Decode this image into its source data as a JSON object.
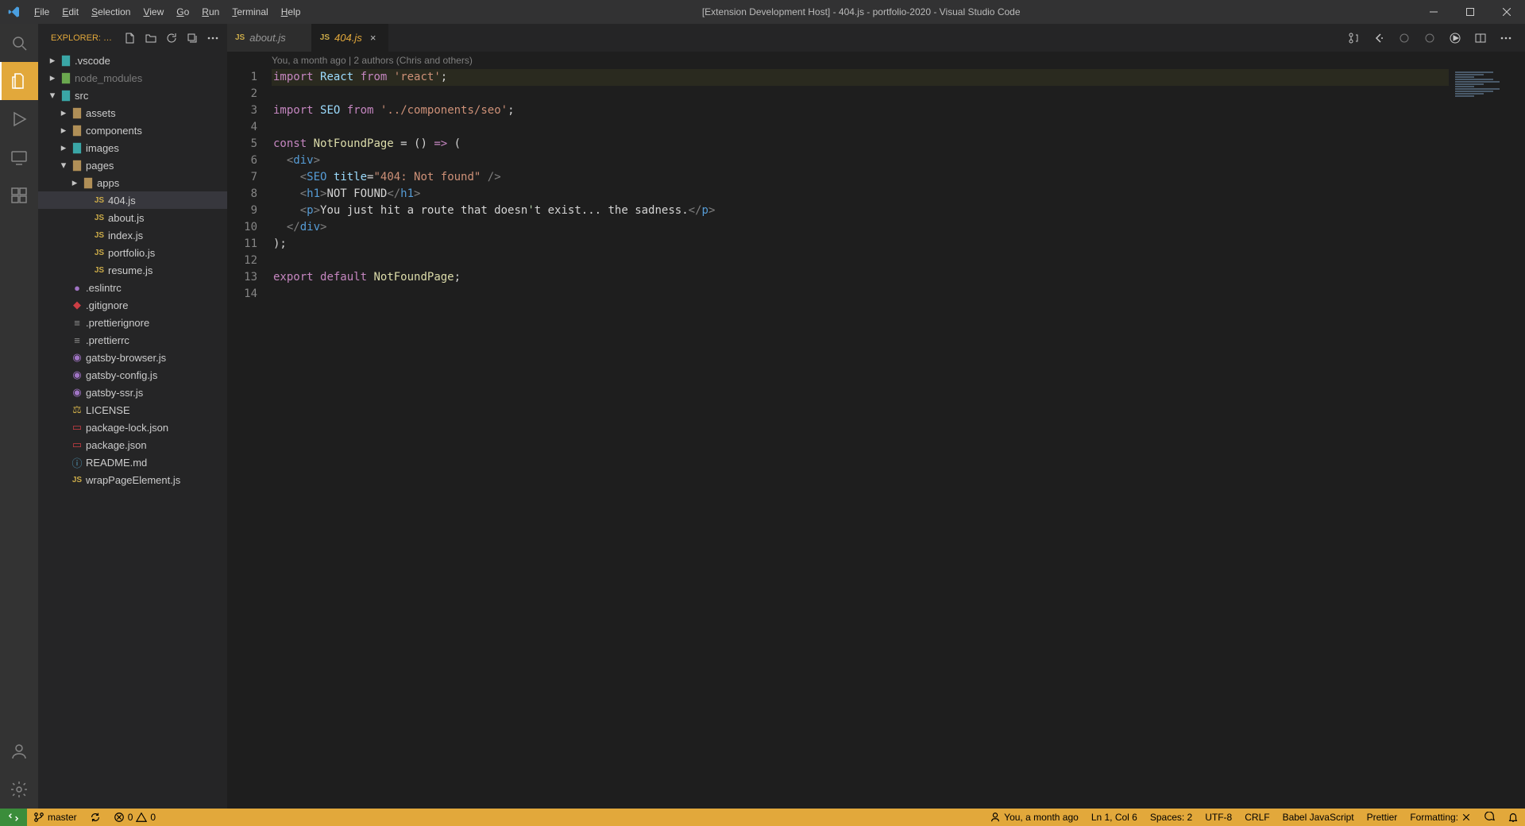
{
  "window": {
    "title": "[Extension Development Host] - 404.js - portfolio-2020 - Visual Studio Code"
  },
  "menu": [
    "File",
    "Edit",
    "Selection",
    "View",
    "Go",
    "Run",
    "Terminal",
    "Help"
  ],
  "sidebar": {
    "title": "EXPLORER: …",
    "tree": [
      {
        "kind": "folder",
        "depth": 0,
        "chev": "right",
        "icon": "folder-teal",
        "label": ".vscode"
      },
      {
        "kind": "folder",
        "depth": 0,
        "chev": "right",
        "icon": "folder-green",
        "label": "node_modules",
        "dim": true
      },
      {
        "kind": "folder",
        "depth": 0,
        "chev": "down",
        "icon": "folder-teal",
        "label": "src"
      },
      {
        "kind": "folder",
        "depth": 1,
        "chev": "right",
        "icon": "folder",
        "label": "assets"
      },
      {
        "kind": "folder",
        "depth": 1,
        "chev": "right",
        "icon": "folder",
        "label": "components"
      },
      {
        "kind": "folder",
        "depth": 1,
        "chev": "right",
        "icon": "folder-teal",
        "label": "images"
      },
      {
        "kind": "folder",
        "depth": 1,
        "chev": "down",
        "icon": "folder",
        "label": "pages"
      },
      {
        "kind": "folder",
        "depth": 2,
        "chev": "right",
        "icon": "folder",
        "label": "apps"
      },
      {
        "kind": "file",
        "depth": 3,
        "icon": "js",
        "label": "404.js",
        "active": true
      },
      {
        "kind": "file",
        "depth": 3,
        "icon": "js",
        "label": "about.js"
      },
      {
        "kind": "file",
        "depth": 3,
        "icon": "js",
        "label": "index.js"
      },
      {
        "kind": "file",
        "depth": 3,
        "icon": "js",
        "label": "portfolio.js"
      },
      {
        "kind": "file",
        "depth": 3,
        "icon": "js",
        "label": "resume.js"
      },
      {
        "kind": "file",
        "depth": 1,
        "icon": "dot-purple",
        "label": ".eslintrc"
      },
      {
        "kind": "file",
        "depth": 1,
        "icon": "git-red",
        "label": ".gitignore"
      },
      {
        "kind": "file",
        "depth": 1,
        "icon": "gray",
        "label": ".prettierignore"
      },
      {
        "kind": "file",
        "depth": 1,
        "icon": "gray",
        "label": ".prettierrc"
      },
      {
        "kind": "file",
        "depth": 1,
        "icon": "purple",
        "label": "gatsby-browser.js"
      },
      {
        "kind": "file",
        "depth": 1,
        "icon": "purple",
        "label": "gatsby-config.js"
      },
      {
        "kind": "file",
        "depth": 1,
        "icon": "purple",
        "label": "gatsby-ssr.js"
      },
      {
        "kind": "file",
        "depth": 1,
        "icon": "yellow",
        "label": "LICENSE"
      },
      {
        "kind": "file",
        "depth": 1,
        "icon": "red",
        "label": "package-lock.json"
      },
      {
        "kind": "file",
        "depth": 1,
        "icon": "red",
        "label": "package.json"
      },
      {
        "kind": "file",
        "depth": 1,
        "icon": "blue",
        "label": "README.md"
      },
      {
        "kind": "file",
        "depth": 1,
        "icon": "js",
        "label": "wrapPageElement.js"
      }
    ]
  },
  "tabs": [
    {
      "icon": "js",
      "label": "about.js",
      "active": false
    },
    {
      "icon": "js",
      "label": "404.js",
      "active": true
    }
  ],
  "blame": "You, a month ago | 2 authors (Chris and others)",
  "code": {
    "lines": [
      [
        {
          "t": "kw",
          "v": "import"
        },
        {
          "t": "txt",
          "v": " "
        },
        {
          "t": "id",
          "v": "React"
        },
        {
          "t": "txt",
          "v": " "
        },
        {
          "t": "kw",
          "v": "from"
        },
        {
          "t": "txt",
          "v": " "
        },
        {
          "t": "str",
          "v": "'react'"
        },
        {
          "t": "txt",
          "v": ";"
        }
      ],
      [],
      [
        {
          "t": "kw",
          "v": "import"
        },
        {
          "t": "txt",
          "v": " "
        },
        {
          "t": "id",
          "v": "SEO"
        },
        {
          "t": "txt",
          "v": " "
        },
        {
          "t": "kw",
          "v": "from"
        },
        {
          "t": "txt",
          "v": " "
        },
        {
          "t": "str",
          "v": "'../components/seo'"
        },
        {
          "t": "txt",
          "v": ";"
        }
      ],
      [],
      [
        {
          "t": "kw",
          "v": "const"
        },
        {
          "t": "txt",
          "v": " "
        },
        {
          "t": "fn",
          "v": "NotFoundPage"
        },
        {
          "t": "txt",
          "v": " = () "
        },
        {
          "t": "kw",
          "v": "=>"
        },
        {
          "t": "txt",
          "v": " ("
        }
      ],
      [
        {
          "t": "txt",
          "v": "  "
        },
        {
          "t": "pun",
          "v": "<"
        },
        {
          "t": "tag",
          "v": "div"
        },
        {
          "t": "pun",
          "v": ">"
        }
      ],
      [
        {
          "t": "txt",
          "v": "    "
        },
        {
          "t": "pun",
          "v": "<"
        },
        {
          "t": "tag",
          "v": "SEO"
        },
        {
          "t": "txt",
          "v": " "
        },
        {
          "t": "attr",
          "v": "title"
        },
        {
          "t": "txt",
          "v": "="
        },
        {
          "t": "str",
          "v": "\"404: Not found\""
        },
        {
          "t": "txt",
          "v": " "
        },
        {
          "t": "pun",
          "v": "/>"
        }
      ],
      [
        {
          "t": "txt",
          "v": "    "
        },
        {
          "t": "pun",
          "v": "<"
        },
        {
          "t": "tag",
          "v": "h1"
        },
        {
          "t": "pun",
          "v": ">"
        },
        {
          "t": "txt",
          "v": "NOT FOUND"
        },
        {
          "t": "pun",
          "v": "</"
        },
        {
          "t": "tag",
          "v": "h1"
        },
        {
          "t": "pun",
          "v": ">"
        }
      ],
      [
        {
          "t": "txt",
          "v": "    "
        },
        {
          "t": "pun",
          "v": "<"
        },
        {
          "t": "tag",
          "v": "p"
        },
        {
          "t": "pun",
          "v": ">"
        },
        {
          "t": "txt",
          "v": "You just hit a route that doesn"
        },
        {
          "t": "num",
          "v": "&#39;"
        },
        {
          "t": "txt",
          "v": "t exist... the sadness."
        },
        {
          "t": "pun",
          "v": "</"
        },
        {
          "t": "tag",
          "v": "p"
        },
        {
          "t": "pun",
          "v": ">"
        }
      ],
      [
        {
          "t": "txt",
          "v": "  "
        },
        {
          "t": "pun",
          "v": "</"
        },
        {
          "t": "tag",
          "v": "div"
        },
        {
          "t": "pun",
          "v": ">"
        }
      ],
      [
        {
          "t": "txt",
          "v": ");"
        }
      ],
      [],
      [
        {
          "t": "kw",
          "v": "export"
        },
        {
          "t": "txt",
          "v": " "
        },
        {
          "t": "kw",
          "v": "default"
        },
        {
          "t": "txt",
          "v": " "
        },
        {
          "t": "fn",
          "v": "NotFoundPage"
        },
        {
          "t": "txt",
          "v": ";"
        }
      ],
      []
    ]
  },
  "status": {
    "branch": "master",
    "errors": "0",
    "warnings": "0",
    "blame": "You, a month ago",
    "cursor": "Ln 1, Col 6",
    "spaces": "Spaces: 2",
    "encoding": "UTF-8",
    "eol": "CRLF",
    "language": "Babel JavaScript",
    "prettier": "Prettier",
    "formatting": "Formatting:"
  }
}
